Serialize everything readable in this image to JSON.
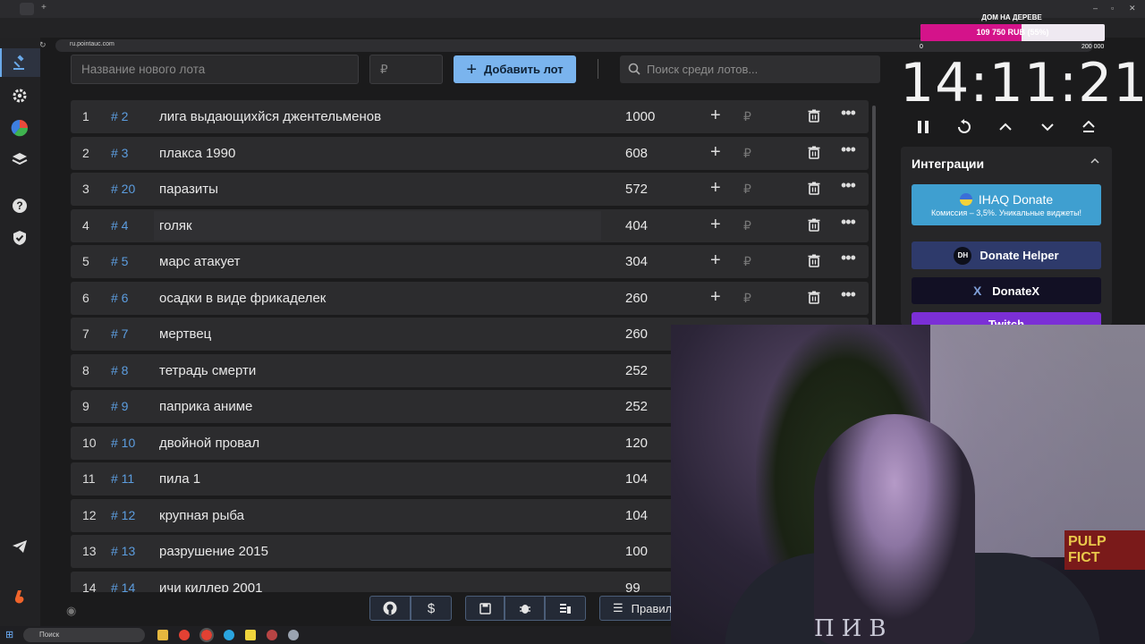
{
  "browser": {
    "url": "ru.pointauc.com"
  },
  "form": {
    "lot_name_placeholder": "Название нового лота",
    "amount_placeholder": "₽",
    "add_button_label": "Добавить лот",
    "search_placeholder": "Поиск среди лотов..."
  },
  "lots": [
    {
      "num": "1",
      "id": "# 2",
      "name": "лига выдающихйся джентельменов",
      "amount": "1000",
      "actions": true
    },
    {
      "num": "2",
      "id": "# 3",
      "name": "плакса 1990",
      "amount": "608",
      "actions": true
    },
    {
      "num": "3",
      "id": "# 20",
      "name": "паразиты",
      "amount": "572",
      "actions": true
    },
    {
      "num": "4",
      "id": "# 4",
      "name": "голяк",
      "amount": "404",
      "actions": true
    },
    {
      "num": "5",
      "id": "# 5",
      "name": "марс атакует",
      "amount": "304",
      "actions": true
    },
    {
      "num": "6",
      "id": "# 6",
      "name": "осадки в виде фрикаделек",
      "amount": "260",
      "actions": true
    },
    {
      "num": "7",
      "id": "# 7",
      "name": "мертвец",
      "amount": "260",
      "actions": false
    },
    {
      "num": "8",
      "id": "# 8",
      "name": "тетрадь смерти",
      "amount": "252",
      "actions": false
    },
    {
      "num": "9",
      "id": "# 9",
      "name": "паприка аниме",
      "amount": "252",
      "actions": false
    },
    {
      "num": "10",
      "id": "# 10",
      "name": " двойной провал",
      "amount": "120",
      "actions": false
    },
    {
      "num": "11",
      "id": "# 11",
      "name": "пила 1",
      "amount": "104",
      "actions": false
    },
    {
      "num": "12",
      "id": "# 12",
      "name": "крупная рыба",
      "amount": "104",
      "actions": false
    },
    {
      "num": "13",
      "id": "# 13",
      "name": "разрушение 2015",
      "amount": "100",
      "actions": false
    },
    {
      "num": "14",
      "id": "# 14",
      "name": "ичи киллер 2001",
      "amount": "99",
      "actions": false
    }
  ],
  "lot_rub_symbol": "₽",
  "bottom": {
    "rules_label": "Правил"
  },
  "goal": {
    "title": "ДОМ НА ДЕРЕВЕ",
    "progress_label": "109 750 RUB (55%)",
    "progress_fraction": 0.55,
    "min": "0",
    "max": "200 000",
    "fill_color": "#d4138a"
  },
  "timer": {
    "value": "14:11:21"
  },
  "integrations": {
    "title": "Интеграции",
    "buttons": [
      {
        "label": "IHAQ Donate",
        "sublabel": "Комиссия – 3,5%. Уникальные виджеты!",
        "color": "#3f9fd0"
      },
      {
        "label": "Donate Helper",
        "badge": "DH",
        "color": "#2e3a6b"
      },
      {
        "label": "DonateX",
        "badge": "X",
        "color": "#121024"
      },
      {
        "label": "Twitch",
        "color": "#7b2fd6"
      }
    ]
  },
  "webcam": {
    "shirt_text": "ПИВ",
    "poster_text": "PULP FICT"
  },
  "taskbar": {
    "search_label": "Поиск"
  }
}
